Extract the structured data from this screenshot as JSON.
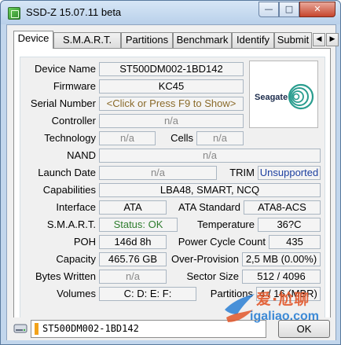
{
  "window": {
    "title": "SSD-Z 15.07.11 beta",
    "controls": {
      "minimize": "—",
      "maximize": "□",
      "close": "✕"
    }
  },
  "tabs": [
    {
      "label": "Device",
      "active": true
    },
    {
      "label": "S.M.A.R.T."
    },
    {
      "label": "Partitions"
    },
    {
      "label": "Benchmark"
    },
    {
      "label": "Identify"
    },
    {
      "label": "Submit"
    }
  ],
  "tab_scroll": {
    "left": "◀",
    "right": "▶"
  },
  "device": {
    "device_name_label": "Device Name",
    "device_name": "ST500DM002-1BD142",
    "firmware_label": "Firmware",
    "firmware": "KC45",
    "serial_label": "Serial Number",
    "serial": "<Click or Press F9 to Show>",
    "controller_label": "Controller",
    "controller": "n/a",
    "technology_label": "Technology",
    "technology": "n/a",
    "cells_label": "Cells",
    "cells": "n/a",
    "nand_label": "NAND",
    "nand": "n/a",
    "launch_date_label": "Launch Date",
    "launch_date": "n/a",
    "trim_label": "TRIM",
    "trim": "Unsupported",
    "capabilities_label": "Capabilities",
    "capabilities": "LBA48, SMART, NCQ",
    "interface_label": "Interface",
    "interface": "ATA",
    "ata_standard_label": "ATA Standard",
    "ata_standard": "ATA8-ACS",
    "smart_label": "S.M.A.R.T.",
    "smart": "Status: OK",
    "temperature_label": "Temperature",
    "temperature": "36?C",
    "poh_label": "POH",
    "poh": "146d 8h",
    "power_cycle_label": "Power Cycle Count",
    "power_cycle": "435",
    "capacity_label": "Capacity",
    "capacity": "465.76 GB",
    "over_provision_label": "Over-Provision",
    "over_provision": "2,5 MB (0.00%)",
    "bytes_written_label": "Bytes Written",
    "bytes_written": "n/a",
    "sector_size_label": "Sector Size",
    "sector_size": "512 / 4096",
    "volumes_label": "Volumes",
    "volumes": "C:  D:  E:  F:",
    "partitions_label": "Partitions",
    "partitions": "4 / 16 (MBR)"
  },
  "logo": {
    "brand": "Seagate",
    "icon": "seagate-swirl-icon"
  },
  "status": {
    "drive": "ST500DM002-1BD142",
    "ok_label": "OK",
    "drive_icon": "hard-drive-icon"
  },
  "watermark": {
    "line1": "爱·尬聊",
    "line2": "igaliao.com"
  },
  "colors": {
    "titlebar": "#c2d6ec",
    "accent_drive": "#f2a21a",
    "status_ok": "#2e7d2e",
    "trim_text": "#1c3fa0"
  }
}
